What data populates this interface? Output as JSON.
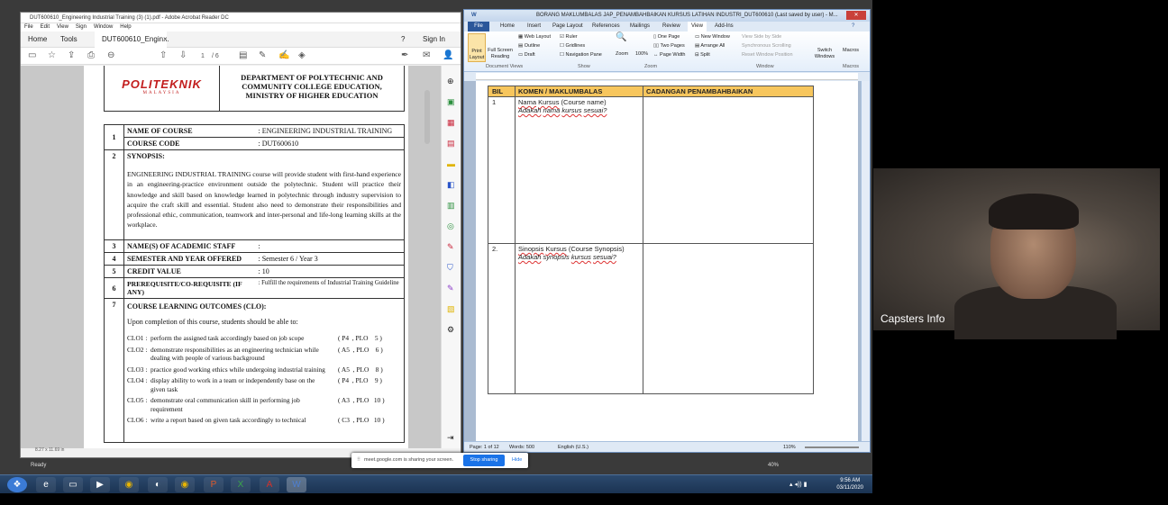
{
  "acrobat": {
    "title": "DUT600610_Engineering Industrial Training (3) (1).pdf - Adobe Acrobat Reader DC",
    "menu": [
      "File",
      "Edit",
      "View",
      "Sign",
      "Window",
      "Help"
    ],
    "tab_home": "Home",
    "tab_tools": "Tools",
    "tab_doc": "DUT600610_Engin...",
    "sign_in": "Sign In",
    "page_current": "1",
    "page_total": "/ 6",
    "page_size": "8.27 x 11.69 in",
    "status": "Ready",
    "document": {
      "dept": "DEPARTMENT OF POLYTECHNIC AND COMMUNITY COLLEGE EDUCATION, MINISTRY OF HIGHER EDUCATION",
      "logo_text": "POLITEKNIK",
      "logo_sub": "MALAYSIA",
      "rows": [
        {
          "no": "1",
          "label": "NAME OF COURSE",
          "value": ": ENGINEERING INDUSTRIAL TRAINING"
        },
        {
          "no": "",
          "label": "COURSE CODE",
          "value": ": DUT600610"
        },
        {
          "no": "2",
          "label": "SYNOPSIS:",
          "value": ""
        },
        {
          "no": "3",
          "label": "NAME(S) OF ACADEMIC STAFF",
          "value": ":"
        },
        {
          "no": "4",
          "label": "SEMESTER AND YEAR OFFERED",
          "value": ": Semester 6 / Year 3"
        },
        {
          "no": "5",
          "label": "CREDIT VALUE",
          "value": ": 10"
        },
        {
          "no": "6",
          "label": "PREREQUISITE/CO-REQUISITE (IF ANY)",
          "value": ": Fulfill the requirements of Industrial Training  Guideline"
        },
        {
          "no": "7",
          "label": "COURSE LEARNING OUTCOMES (CLO):",
          "value": ""
        }
      ],
      "synopsis": "ENGINEERING INDUSTRIAL TRAINING course will provide student with first-hand experience in an engineering-practice environment outside the polytechnic. Student will practice their knowledge and skill based on knowledge learned in polytechnic through industry supervision to acquire the craft skill and essential. Student also need to demonstrate their responsibilities and professional ethic, communication, teamwork and inter-personal and life-long learning skills at the workplace.",
      "clo_intro": "Upon completion of this course, students should be able to:",
      "clos": [
        {
          "id": "CLO1 :",
          "text": "perform  the assigned task accordingly based on job scope",
          "code": "( P4  , PLO    5 )"
        },
        {
          "id": "CLO2 :",
          "text": "demonstrate responsibilities as an engineering technician while dealing with people of various background",
          "code": "( A5  , PLO    6 )"
        },
        {
          "id": "CLO3 :",
          "text": "practice good working ethics while undergoing industrial training",
          "code": "( A5  , PLO    8 )"
        },
        {
          "id": "CLO4 :",
          "text": "display ability to work in a team or independently base on the given task",
          "code": "( P4  , PLO    9 )"
        },
        {
          "id": "CLO5 :",
          "text": "demonstrate  oral communication skill in performing job requirement",
          "code": "( A3  , PLO   10 )"
        },
        {
          "id": "CLO6 :",
          "text": "write a report based on given task accordingly to technical",
          "code": "( C3  , PLO   10 )"
        }
      ]
    }
  },
  "word": {
    "title": "BORANG MAKLUMBALAS JAP_PENAMBAHBAIKAN KURSUS LATIHAN INDUSTRI_DUT600610 (Last saved by user) - M...",
    "tabs": [
      "File",
      "Home",
      "Insert",
      "Page Layout",
      "References",
      "Mailings",
      "Review",
      "View",
      "Add-Ins"
    ],
    "ribbon": {
      "print_layout": "Print Layout",
      "full_screen": "Full Screen Reading",
      "web_layout": "Web Layout",
      "outline": "Outline",
      "draft": "Draft",
      "ruler": "Ruler",
      "gridlines": "Gridlines",
      "nav_pane": "Navigation Pane",
      "zoom": "Zoom",
      "zoom100": "100%",
      "one_page": "One Page",
      "two_pages": "Two Pages",
      "page_width": "Page Width",
      "new_window": "New Window",
      "arrange_all": "Arrange All",
      "split": "Split",
      "view_side": "View Side by Side",
      "sync_scroll": "Synchronous Scrolling",
      "reset_pos": "Reset Window Position",
      "switch_windows": "Switch Windows",
      "macros": "Macros",
      "grp_doc_views": "Document Views",
      "grp_show": "Show",
      "grp_zoom": "Zoom",
      "grp_window": "Window",
      "grp_macros": "Macros"
    },
    "table": {
      "h_bil": "BIL",
      "h_komen": "KOMEN / MAKLUMBALAS",
      "h_cadangan": "CADANGAN PENAMBAHBAIKAN",
      "rows": [
        {
          "no": "1",
          "line1a": "Nama",
          "line1b": "Kursus",
          "line1c": "(Course name)",
          "line2a": "Adakah",
          "line2b": "nama",
          "line2c": "kursus",
          "line2d": "sesuai?"
        },
        {
          "no": "2.",
          "line1a": "Sinopsis",
          "line1b": "Kursus",
          "line1c": "(Course Synopsis)",
          "line2a": "Adakah",
          "line2b": "synopsis",
          "line2c": "kursus",
          "line2d": "sesuai?"
        }
      ]
    },
    "status_page": "Page: 1 of 12",
    "status_words": "Words: 500",
    "status_lang": "English (U.S.)",
    "status_zoom": "110%",
    "status_zoom2": "40%"
  },
  "share_bar": {
    "text": "meet.google.com is sharing your screen.",
    "stop": "Stop sharing",
    "hide": "Hide"
  },
  "webcam": {
    "name": "Capsters Info"
  },
  "clock": {
    "time": "9:56 AM",
    "date": "03/11/2020"
  }
}
